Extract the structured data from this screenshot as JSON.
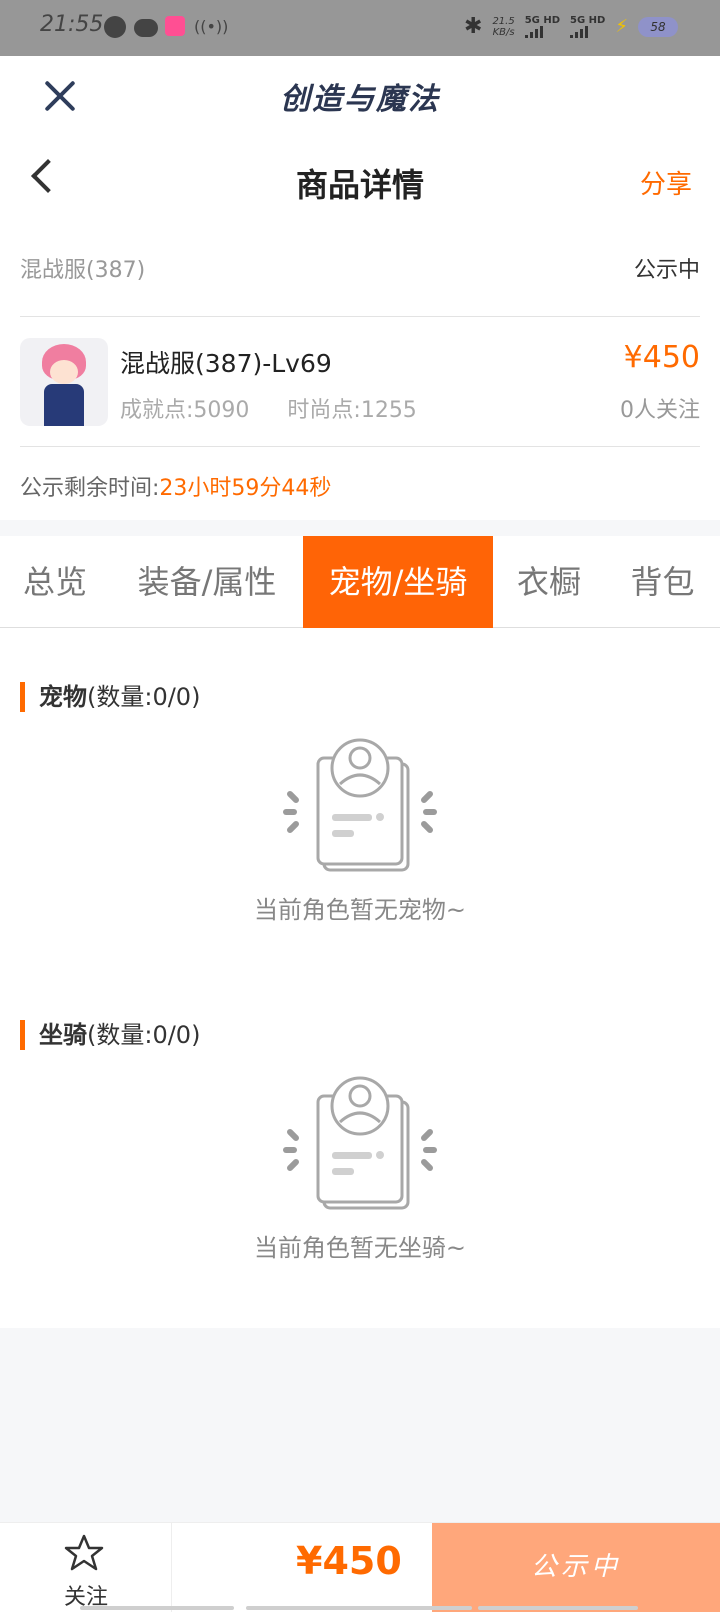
{
  "status_bar": {
    "time": "21:55",
    "net_rate_value": "21.5",
    "net_rate_unit": "KB/s",
    "sim1": "5G HD",
    "sim2": "5G HD",
    "battery": "58"
  },
  "app": {
    "title": "创造与魔法"
  },
  "nav": {
    "title": "商品详情",
    "share_label": "分享"
  },
  "listing": {
    "server": "混战服(387)",
    "status": "公示中",
    "item_name": "混战服(387)-Lv69",
    "achievement": "成就点:5090",
    "fashion": "时尚点:1255",
    "price": "¥450",
    "followers": "0人关注",
    "remaining_label": "公示剩余时间:",
    "remaining_time": "23小时59分44秒"
  },
  "tabs": [
    {
      "label": "总览",
      "active": false
    },
    {
      "label": "装备/属性",
      "active": false
    },
    {
      "label": "宠物/坐骑",
      "active": true
    },
    {
      "label": "衣橱",
      "active": false
    },
    {
      "label": "背包",
      "active": false
    }
  ],
  "pets": {
    "title": "宠物",
    "count": "(数量:0/0)",
    "empty_text": "当前角色暂无宠物~"
  },
  "mounts": {
    "title": "坐骑",
    "count": "(数量:0/0)",
    "empty_text": "当前角色暂无坐骑~"
  },
  "bottom_bar": {
    "follow_label": "关注",
    "price": "¥450",
    "action_label": "公示中"
  },
  "colors": {
    "accent": "#ff6406",
    "action_disabled": "#ffa77b"
  }
}
